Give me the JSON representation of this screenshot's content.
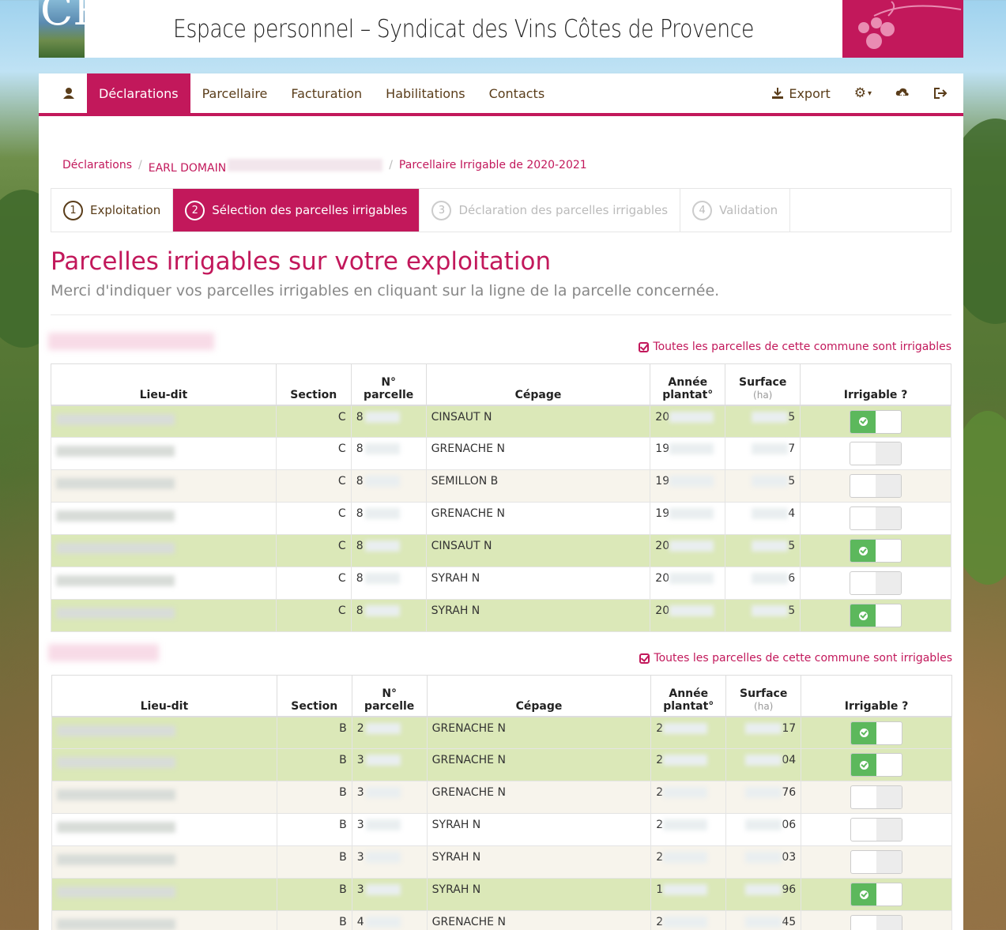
{
  "banner": {
    "logo_text": "CP",
    "title": "Espace personnel – Syndicat des Vins Côtes de Provence"
  },
  "nav": {
    "items": [
      {
        "label": "Déclarations"
      },
      {
        "label": "Parcellaire"
      },
      {
        "label": "Facturation"
      },
      {
        "label": "Habilitations"
      },
      {
        "label": "Contacts"
      }
    ],
    "export_label": "Export",
    "icons": [
      "user-icon",
      "download-icon",
      "gear-icon",
      "upload-icon",
      "logout-icon"
    ]
  },
  "breadcrumb": {
    "items": [
      "Déclarations",
      "EARL DOMAIN",
      "Parcellaire Irrigable de 2020-2021"
    ]
  },
  "steps": [
    {
      "num": "1",
      "label": "Exploitation"
    },
    {
      "num": "2",
      "label": "Sélection des parcelles irrigables"
    },
    {
      "num": "3",
      "label": "Déclaration des parcelles irrigables"
    },
    {
      "num": "4",
      "label": "Validation"
    }
  ],
  "page": {
    "title": "Parcelles irrigables sur votre exploitation",
    "lead": "Merci d'indiquer vos parcelles irrigables en cliquant sur la ligne de la parcelle concernée.",
    "all_irrigable": "Toutes les parcelles de cette commune sont irrigables"
  },
  "table_headers": {
    "lieu": "Lieu-dit",
    "section": "Section",
    "parcelle": "N° parcelle",
    "cepage": "Cépage",
    "annee": "Année plantat°",
    "surface": "Surface",
    "unit": "(ha)",
    "irrigable": "Irrigable ?"
  },
  "groups": [
    {
      "rows": [
        {
          "section": "C",
          "parcelle": "8",
          "cepage": "CINSAUT N",
          "annee": "20",
          "surface": "5",
          "irrigable": true,
          "style": "irr"
        },
        {
          "section": "C",
          "parcelle": "8",
          "cepage": "GRENACHE N",
          "annee": "19",
          "surface": "7",
          "irrigable": false,
          "style": "plain"
        },
        {
          "section": "C",
          "parcelle": "8",
          "cepage": "SEMILLON B",
          "annee": "19",
          "surface": "5",
          "irrigable": false,
          "style": "alt"
        },
        {
          "section": "C",
          "parcelle": "8",
          "cepage": "GRENACHE N",
          "annee": "19",
          "surface": "4",
          "irrigable": false,
          "style": "plain"
        },
        {
          "section": "C",
          "parcelle": "8",
          "cepage": "CINSAUT N",
          "annee": "20",
          "surface": "5",
          "irrigable": true,
          "style": "irr"
        },
        {
          "section": "C",
          "parcelle": "8",
          "cepage": "SYRAH N",
          "annee": "20",
          "surface": "6",
          "irrigable": false,
          "style": "plain"
        },
        {
          "section": "C",
          "parcelle": "8",
          "cepage": "SYRAH N",
          "annee": "20",
          "surface": "5",
          "irrigable": true,
          "style": "irr"
        }
      ]
    },
    {
      "rows": [
        {
          "section": "B",
          "parcelle": "2",
          "cepage": "GRENACHE N",
          "annee": "2",
          "surface": "17",
          "irrigable": true,
          "style": "irr"
        },
        {
          "section": "B",
          "parcelle": "3",
          "cepage": "GRENACHE N",
          "annee": "2",
          "surface": "04",
          "irrigable": true,
          "style": "irr"
        },
        {
          "section": "B",
          "parcelle": "3",
          "cepage": "GRENACHE N",
          "annee": "2",
          "surface": "76",
          "irrigable": false,
          "style": "alt"
        },
        {
          "section": "B",
          "parcelle": "3",
          "cepage": "SYRAH N",
          "annee": "2",
          "surface": "06",
          "irrigable": false,
          "style": "plain"
        },
        {
          "section": "B",
          "parcelle": "3",
          "cepage": "SYRAH N",
          "annee": "2",
          "surface": "03",
          "irrigable": false,
          "style": "alt"
        },
        {
          "section": "B",
          "parcelle": "3",
          "cepage": "SYRAH N",
          "annee": "1",
          "surface": "96",
          "irrigable": true,
          "style": "irr"
        },
        {
          "section": "B",
          "parcelle": "4",
          "cepage": "GRENACHE N",
          "annee": "2",
          "surface": "45",
          "irrigable": false,
          "style": "alt"
        }
      ]
    }
  ],
  "colors": {
    "brand": "#c2185b",
    "irrigable_row": "#dbe8b8",
    "toggle_on": "#5cb85c"
  }
}
